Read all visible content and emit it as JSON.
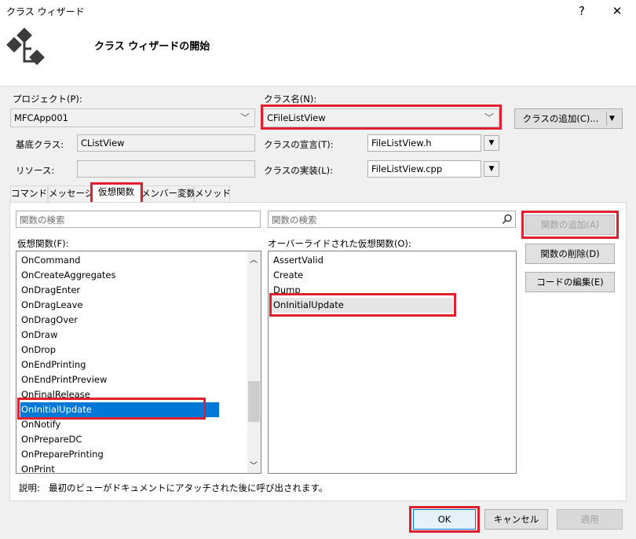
{
  "window": {
    "title": "クラス ウィザード",
    "help_button": "?",
    "close_button": "✕"
  },
  "header": {
    "title": "クラス ウィザードの開始",
    "icon": "class-wizard-icon"
  },
  "fields": {
    "project_label": "プロジェクト(P):",
    "project_value": "MFCApp001",
    "classname_label": "クラス名(N):",
    "classname_value": "CFileListView",
    "add_class_button": "クラスの追加(C)...",
    "base_class_label": "基底クラス:",
    "base_class_value": "CListView",
    "resource_label": "リソース:",
    "resource_value": "",
    "declaration_label": "クラスの宣言(T):",
    "declaration_value": "FileListView.h",
    "implementation_label": "クラスの実装(L):",
    "implementation_value": "FileListView.cpp"
  },
  "tabs": [
    "コマンド",
    "メッセージ",
    "仮想関数",
    "メンバー変数",
    "メソッド"
  ],
  "active_tab": "仮想関数",
  "left": {
    "search_placeholder": "関数の検索",
    "list_label": "仮想関数(F):",
    "items": [
      "OnCommand",
      "OnCreateAggregates",
      "OnDragEnter",
      "OnDragLeave",
      "OnDragOver",
      "OnDraw",
      "OnDrop",
      "OnEndPrinting",
      "OnEndPrintPreview",
      "OnFinalRelease",
      "OnInitialUpdate",
      "OnNotify",
      "OnPrepareDC",
      "OnPreparePrinting",
      "OnPrint"
    ],
    "selected": "OnInitialUpdate"
  },
  "right": {
    "search_placeholder": "関数の検索",
    "list_label": "オーバーライドされた仮想関数(O):",
    "items": [
      "AssertValid",
      "Create",
      "Dump",
      "OnInitialUpdate"
    ]
  },
  "side_buttons": {
    "add_function": "関数の追加(A)",
    "delete_function": "関数の削除(D)",
    "edit_code": "コードの編集(E)"
  },
  "description": {
    "label": "説明:",
    "text": "最初のビューがドキュメントにアタッチされた後に呼び出されます。"
  },
  "footer": {
    "ok": "OK",
    "cancel": "キャンセル",
    "apply": "適用"
  },
  "colors": {
    "highlight_red": "#e0202e",
    "selection_blue": "#0078d7"
  }
}
